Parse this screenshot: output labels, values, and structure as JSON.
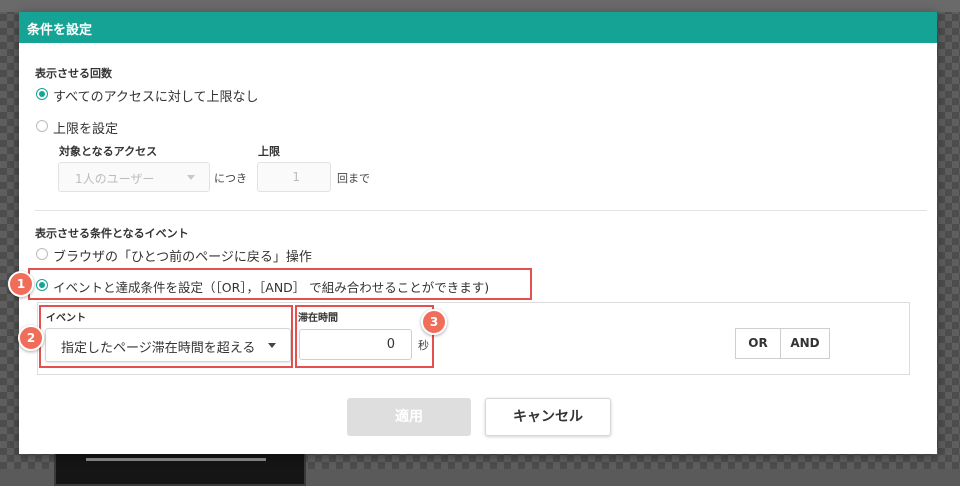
{
  "dialog": {
    "title": "条件を設定"
  },
  "display_count": {
    "section_label": "表示させる回数",
    "option_unlimited": "すべてのアクセスに対して上限なし",
    "option_set_limit": "上限を設定",
    "target_access_label": "対象となるアクセス",
    "limit_label": "上限",
    "target_select_value": "1人のユーザー",
    "per_text": "につき",
    "limit_value": "1",
    "until_text": "回まで"
  },
  "condition_event": {
    "section_label": "表示させる条件となるイベント",
    "option_browser_back": "ブラウザの「ひとつ前のページに戻る」操作",
    "option_event_conditions": "イベントと達成条件を設定（［OR］，［AND］ で組み合わせることができます)",
    "event_label": "イベント",
    "event_select_value": "指定したページ滞在時間を超える",
    "stay_time_label": "滞在時間",
    "stay_time_value": "0",
    "seconds_unit": "秒",
    "or_button": "OR",
    "and_button": "AND"
  },
  "annotations": {
    "badge1": "1",
    "badge2": "2",
    "badge3": "3",
    "highlight_color": "#e45050",
    "badge_color": "#f06d5a"
  },
  "footer": {
    "apply_button": "適用",
    "cancel_button": "キャンセル"
  },
  "colors": {
    "accent": "#14a394"
  }
}
